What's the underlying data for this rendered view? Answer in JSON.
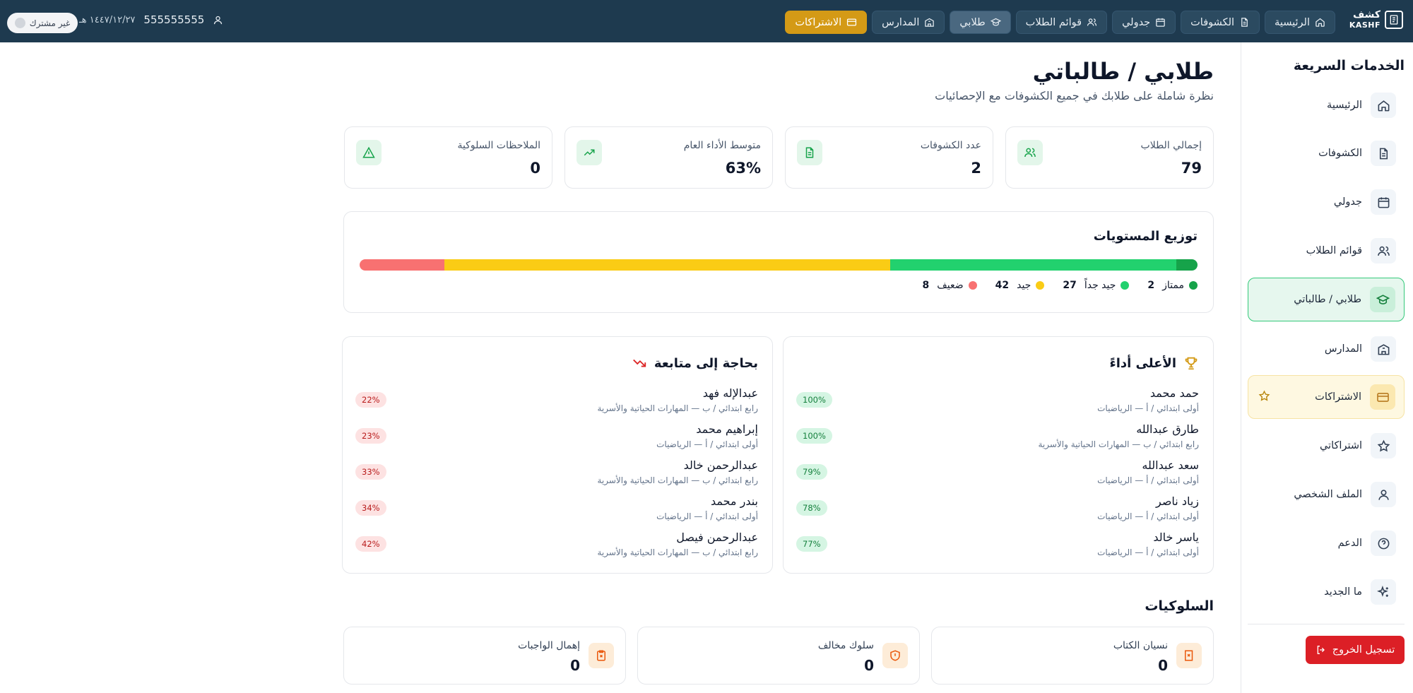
{
  "brand": {
    "name_ar": "كشف",
    "name_en": "KASHF"
  },
  "topnav": [
    {
      "label": "الرئيسية",
      "icon": "home-icon"
    },
    {
      "label": "الكشوفات",
      "icon": "file-icon"
    },
    {
      "label": "جدولي",
      "icon": "calendar-icon"
    },
    {
      "label": "قوائم الطلاب",
      "icon": "users-icon"
    },
    {
      "label": "طلابي",
      "icon": "graduation-cap-icon"
    },
    {
      "label": "المدارس",
      "icon": "school-icon"
    },
    {
      "label": "الاشتراكات",
      "icon": "credit-card-icon"
    }
  ],
  "user": {
    "phone": "555555555",
    "hijri_date": "١٤٤٧/١٢/٢٧ هـ",
    "subscription_status": "غير مشترك"
  },
  "sidebar": {
    "title": "الخدمات السريعة",
    "items": [
      {
        "label": "الرئيسية",
        "icon": "home-icon"
      },
      {
        "label": "الكشوفات",
        "icon": "file-icon"
      },
      {
        "label": "جدولي",
        "icon": "calendar-icon"
      },
      {
        "label": "قوائم الطلاب",
        "icon": "users-icon"
      },
      {
        "label": "طلابي / طالباتي",
        "icon": "graduation-cap-icon"
      },
      {
        "label": "المدارس",
        "icon": "school-icon"
      },
      {
        "label": "الاشتراكات",
        "icon": "credit-card-icon"
      },
      {
        "label": "اشتراكاتي",
        "icon": "star-icon"
      },
      {
        "label": "الملف الشخصي",
        "icon": "user-icon"
      },
      {
        "label": "الدعم",
        "icon": "help-icon"
      },
      {
        "label": "ما الجديد",
        "icon": "sparkles-icon"
      }
    ],
    "logout": "تسجيل الخروج"
  },
  "page": {
    "title": "طلابي / طالباتي",
    "subtitle": "نظرة شاملة على طلابك في جميع الكشوفات مع الإحصائيات"
  },
  "stats": [
    {
      "label": "إجمالي الطلاب",
      "value": "79",
      "icon": "users-icon",
      "color": "#16a34a"
    },
    {
      "label": "عدد الكشوفات",
      "value": "2",
      "icon": "file-text-icon",
      "color": "#16a34a"
    },
    {
      "label": "متوسط الأداء العام",
      "value": "63%",
      "icon": "trending-up-icon",
      "color": "#16a34a"
    },
    {
      "label": "الملاحظات السلوكية",
      "value": "0",
      "icon": "alert-triangle-icon",
      "color": "#16a34a"
    }
  ],
  "distribution": {
    "title": "توزيع المستويات",
    "levels": [
      {
        "label": "ممتاز",
        "count": 2,
        "color": "#16a34a"
      },
      {
        "label": "جيد جداً",
        "count": 27,
        "color": "#22d16e"
      },
      {
        "label": "جيد",
        "count": 42,
        "color": "#facc15"
      },
      {
        "label": "ضعيف",
        "count": 8,
        "color": "#f87171"
      }
    ]
  },
  "top_performers": {
    "title": "الأعلى أداءً",
    "rows": [
      {
        "name": "حمد محمد",
        "meta": "أولى ابتدائي / أ — الرياضيات",
        "pct": "100%"
      },
      {
        "name": "طارق عبدالله",
        "meta": "رابع ابتدائي / ب — المهارات الحياتية والأسرية",
        "pct": "100%"
      },
      {
        "name": "سعد عبدالله",
        "meta": "أولى ابتدائي / أ — الرياضيات",
        "pct": "79%"
      },
      {
        "name": "زياد ناصر",
        "meta": "أولى ابتدائي / أ — الرياضيات",
        "pct": "78%"
      },
      {
        "name": "ياسر خالد",
        "meta": "أولى ابتدائي / أ — الرياضيات",
        "pct": "77%"
      }
    ]
  },
  "needs_followup": {
    "title": "بحاجة إلى متابعة",
    "rows": [
      {
        "name": "عبدالإله فهد",
        "meta": "رابع ابتدائي / ب — المهارات الحياتية والأسرية",
        "pct": "22%"
      },
      {
        "name": "إبراهيم محمد",
        "meta": "أولى ابتدائي / أ — الرياضيات",
        "pct": "23%"
      },
      {
        "name": "عبدالرحمن خالد",
        "meta": "رابع ابتدائي / ب — المهارات الحياتية والأسرية",
        "pct": "33%"
      },
      {
        "name": "بندر محمد",
        "meta": "أولى ابتدائي / أ — الرياضيات",
        "pct": "34%"
      },
      {
        "name": "عبدالرحمن فيصل",
        "meta": "رابع ابتدائي / ب — المهارات الحياتية والأسرية",
        "pct": "42%"
      }
    ]
  },
  "behaviors": {
    "title": "السلوكيات",
    "items": [
      {
        "label": "نسيان الكتاب",
        "value": "0",
        "icon": "book-x-icon"
      },
      {
        "label": "سلوك مخالف",
        "value": "0",
        "icon": "shield-alert-icon"
      },
      {
        "label": "إهمال الواجبات",
        "value": "0",
        "icon": "clipboard-x-icon"
      }
    ]
  }
}
